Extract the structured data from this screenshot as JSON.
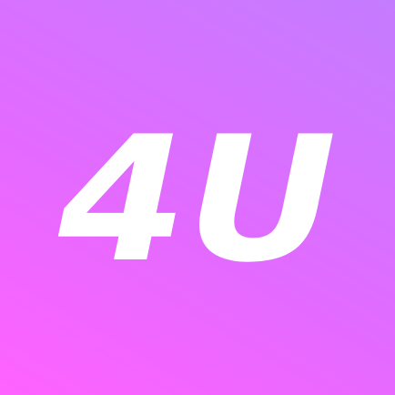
{
  "app_icon": {
    "logo_text": "4U",
    "colors": {
      "gradient_start": "#ff62ff",
      "gradient_mid": "#e26bff",
      "gradient_end": "#c47cff",
      "logo_fill": "#ffffff"
    }
  }
}
